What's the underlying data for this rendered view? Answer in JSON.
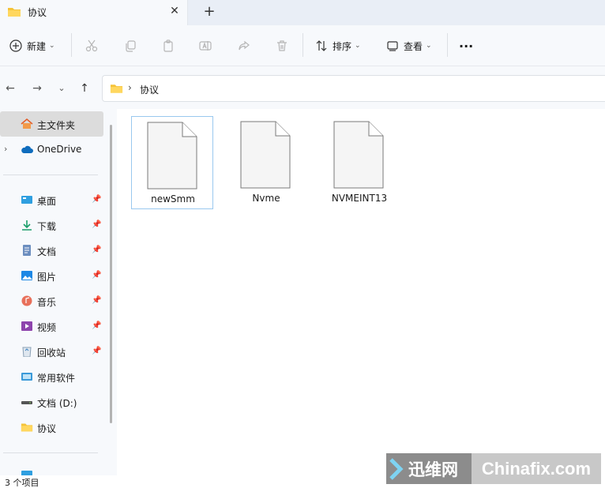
{
  "tab": {
    "title": "协议",
    "close": "✕",
    "new_tab": "+"
  },
  "toolbar": {
    "new_label": "新建",
    "sort_label": "排序",
    "view_label": "查看",
    "more": "···"
  },
  "nav": {
    "back": "←",
    "forward": "→",
    "recent": "⌄",
    "up": "↑"
  },
  "address": {
    "separator": "›",
    "crumb": "协议"
  },
  "sidebar": {
    "home": "主文件夹",
    "onedrive": "OneDrive",
    "items": [
      {
        "label": "桌面",
        "icon": "desktop-icon"
      },
      {
        "label": "下载",
        "icon": "download-icon"
      },
      {
        "label": "文档",
        "icon": "documents-icon"
      },
      {
        "label": "图片",
        "icon": "pictures-icon"
      },
      {
        "label": "音乐",
        "icon": "music-icon"
      },
      {
        "label": "视频",
        "icon": "videos-icon"
      },
      {
        "label": "回收站",
        "icon": "recycle-bin-icon"
      },
      {
        "label": "常用软件",
        "icon": "software-folder-icon"
      },
      {
        "label": "文档 (D:)",
        "icon": "drive-icon"
      },
      {
        "label": "协议",
        "icon": "folder-icon"
      }
    ]
  },
  "files": [
    {
      "name": "newSmm"
    },
    {
      "name": "Nvme"
    },
    {
      "name": "NVMEINT13"
    }
  ],
  "status": {
    "text": "3 个项目"
  },
  "watermark": {
    "left": "迅维网",
    "right": "Chinafix.com"
  },
  "colors": {
    "folder": "#f5c338",
    "accent": "#0078d4",
    "selection": "#9ac8ef"
  }
}
